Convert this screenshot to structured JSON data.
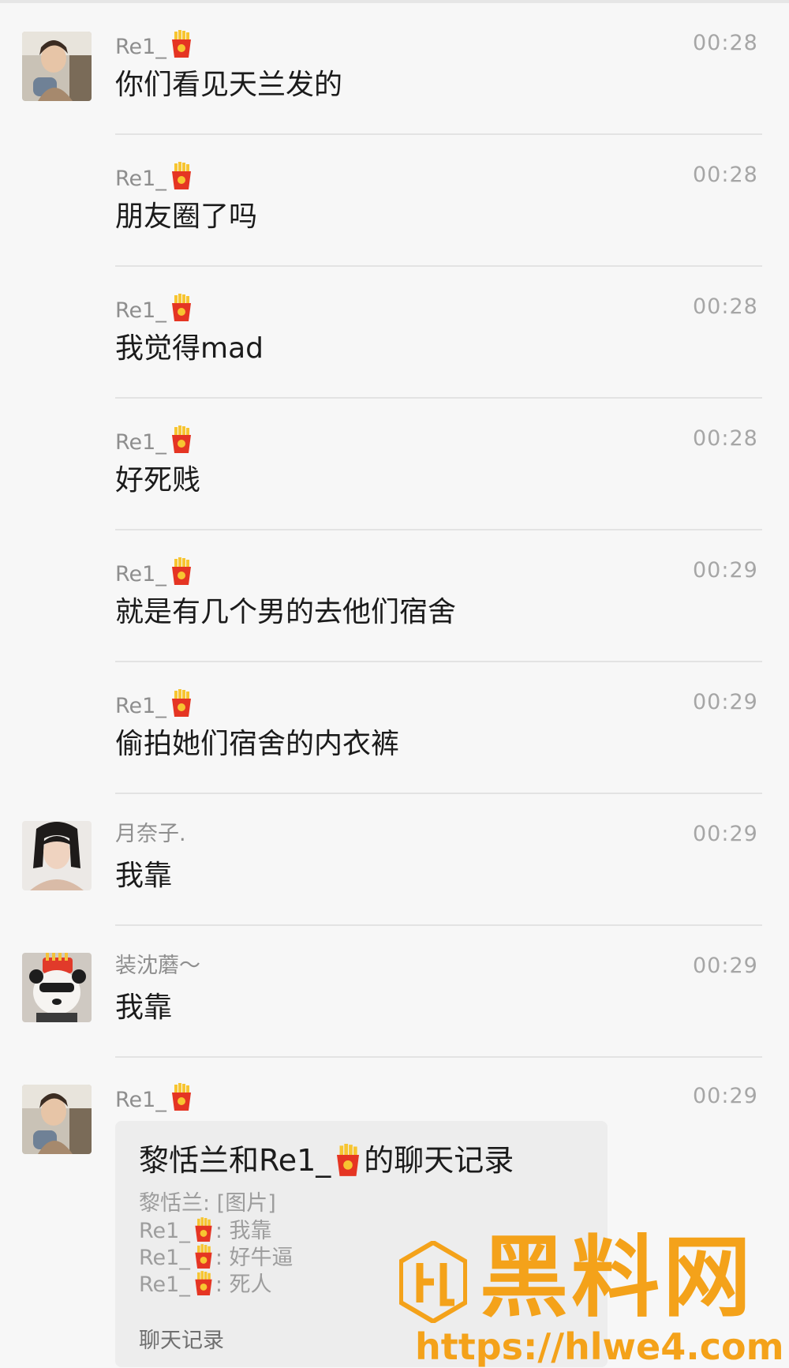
{
  "messages": [
    {
      "sender": "Re1_",
      "sender_emoji": "fries-icon",
      "time": "00:28",
      "text": "你们看见天兰发的",
      "avatar": "photo-girl-1"
    },
    {
      "sender": "Re1_",
      "sender_emoji": "fries-icon",
      "time": "00:28",
      "text": "朋友圈了吗"
    },
    {
      "sender": "Re1_",
      "sender_emoji": "fries-icon",
      "time": "00:28",
      "text": "我觉得mad"
    },
    {
      "sender": "Re1_",
      "sender_emoji": "fries-icon",
      "time": "00:28",
      "text": "好死贱"
    },
    {
      "sender": "Re1_",
      "sender_emoji": "fries-icon",
      "time": "00:29",
      "text": "就是有几个男的去他们宿舍"
    },
    {
      "sender": "Re1_",
      "sender_emoji": "fries-icon",
      "time": "00:29",
      "text": "偷拍她们宿舍的内衣裤"
    },
    {
      "sender": "月奈子.",
      "time": "00:29",
      "text": "我靠",
      "avatar": "photo-girl-2"
    },
    {
      "sender": "装沈蘑～",
      "time": "00:29",
      "text": "我靠",
      "avatar": "panda-sunglasses"
    },
    {
      "sender": "Re1_",
      "sender_emoji": "fries-icon",
      "time": "00:29",
      "avatar": "photo-girl-1"
    }
  ],
  "chat_record_card": {
    "title_prefix": "黎恬兰和Re1_",
    "title_suffix": "的聊天记录",
    "lines": [
      {
        "name": "黎恬兰",
        "text": ": [图片]"
      },
      {
        "name": "Re1_",
        "emoji": "fries-icon",
        "text": ": 我靠"
      },
      {
        "name": "Re1_",
        "emoji": "fries-icon",
        "text": ": 好牛逼"
      },
      {
        "name": "Re1_",
        "emoji": "fries-icon",
        "text": ": 死人"
      }
    ],
    "footer": "聊天记录"
  },
  "watermark": {
    "title": "黑料网",
    "url": "https://hlwe4.com",
    "color": "#f4a21a"
  },
  "colors": {
    "background": "#f7f7f7",
    "name": "#8e8e8e",
    "time": "#a6a6a6",
    "message_text": "#1b1b1b",
    "card_bg": "#ededed"
  }
}
